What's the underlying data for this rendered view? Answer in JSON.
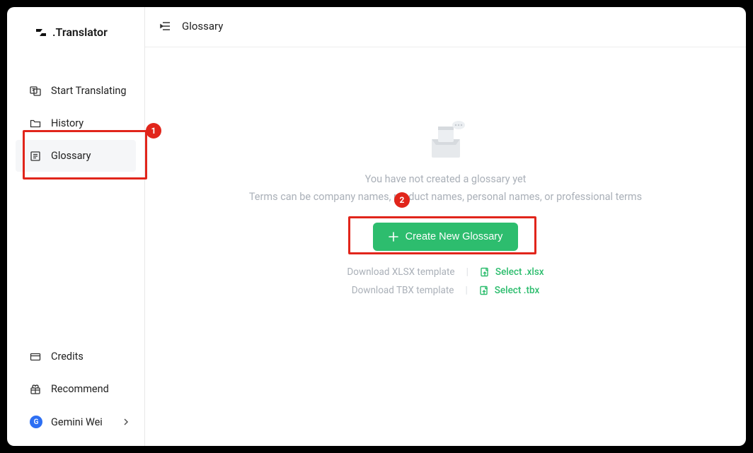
{
  "app": {
    "name": ".Translator"
  },
  "sidebar": {
    "top_items": [
      {
        "label": "Start Translating",
        "icon": "translate-icon"
      },
      {
        "label": "History",
        "icon": "folder-icon"
      },
      {
        "label": "Glossary",
        "icon": "list-icon",
        "active": true
      }
    ],
    "bottom_items": [
      {
        "label": "Credits",
        "icon": "card-icon"
      },
      {
        "label": "Recommend",
        "icon": "gift-icon"
      }
    ],
    "user": {
      "name": "Gemini Wei",
      "initial": "G"
    }
  },
  "topbar": {
    "title": "Glossary",
    "icon": "collapse-icon"
  },
  "empty": {
    "title": "You have not created a glossary yet",
    "subtitle": "Terms can be company names, product names, personal names, or professional terms",
    "button": "Create New Glossary"
  },
  "templates": [
    {
      "label": "Download XLSX template",
      "link": "Select .xlsx"
    },
    {
      "label": "Download TBX template",
      "link": "Select .tbx"
    }
  ],
  "callouts": {
    "one": "1",
    "two": "2"
  }
}
